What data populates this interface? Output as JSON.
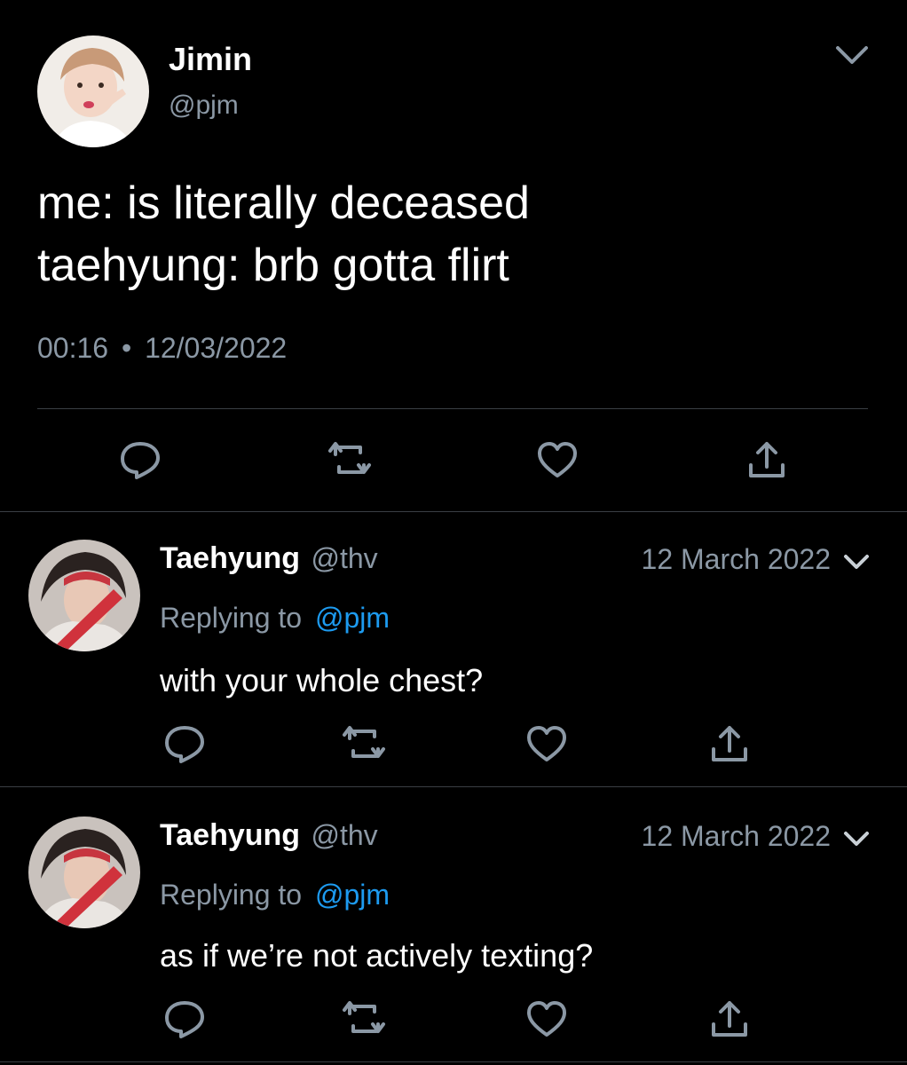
{
  "main_tweet": {
    "author": {
      "name": "Jimin",
      "handle": "@pjm",
      "avatar_icon": "jimin-avatar"
    },
    "text_lines": [
      "me: is literally deceased",
      "taehyung: brb gotta flirt"
    ],
    "time": "00:16",
    "separator": "•",
    "date": "12/03/2022",
    "menu_icon": "chevron-down-icon",
    "actions": [
      "reply-icon",
      "retweet-icon",
      "like-icon",
      "share-icon"
    ]
  },
  "replies": [
    {
      "name": "Taehyung",
      "handle": "@thv",
      "date": "12 March 2022",
      "replying_prefix": "Replying to",
      "replying_to": "@pjm",
      "text": "with your whole chest?"
    },
    {
      "name": "Taehyung",
      "handle": "@thv",
      "date": "12 March 2022",
      "replying_prefix": "Replying to",
      "replying_to": "@pjm",
      "text": "as if we’re not actively texting?"
    }
  ],
  "colors": {
    "background": "#000000",
    "text": "#ffffff",
    "secondary": "#8b98a5",
    "accent": "#1d9bf0",
    "divider": "#3a3f44"
  }
}
